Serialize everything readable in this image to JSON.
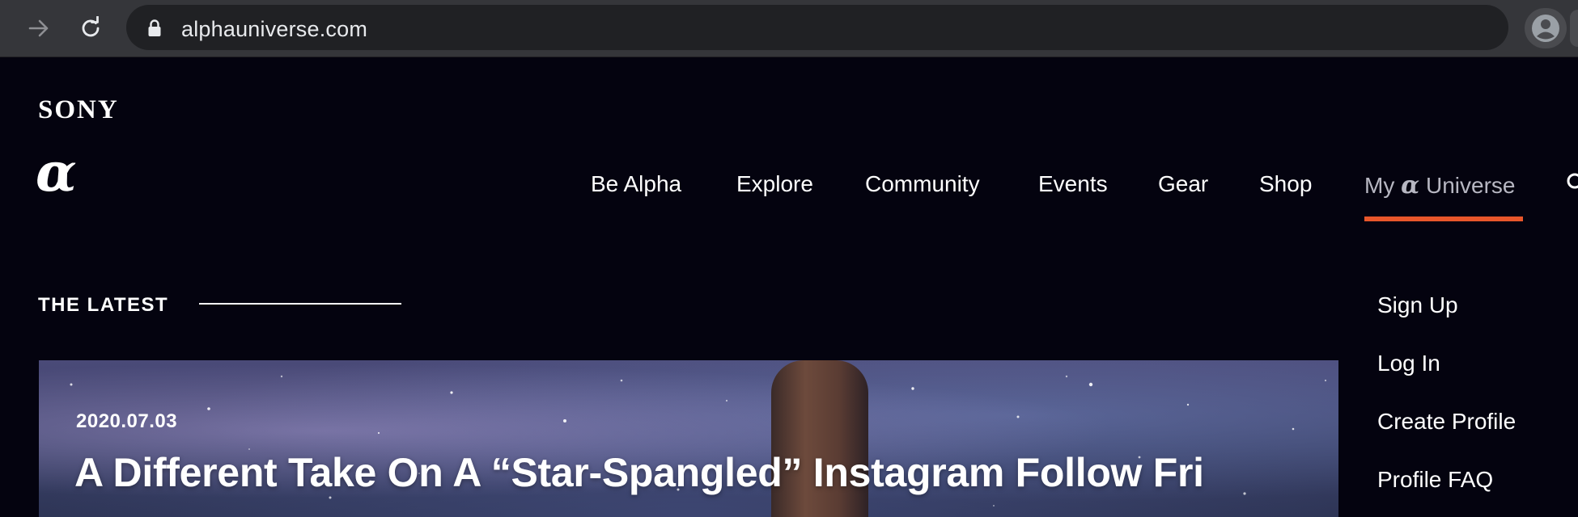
{
  "browser": {
    "url": "alphauniverse.com",
    "icons": {
      "forward": "arrow-right-icon",
      "reload": "reload-icon",
      "lock": "lock-icon",
      "profile": "user-avatar-icon"
    }
  },
  "site": {
    "brand": "SONY",
    "alpha_mark": "α"
  },
  "nav": {
    "items": [
      {
        "label": "Be Alpha"
      },
      {
        "label": "Explore"
      },
      {
        "label": "Community"
      },
      {
        "label": "Events"
      },
      {
        "label": "Gear"
      },
      {
        "label": "Shop"
      }
    ],
    "my_universe": {
      "prefix": "My",
      "glyph": "α",
      "suffix": "Universe"
    },
    "accent_color": "#e8562a"
  },
  "latest": {
    "label": "THE LATEST",
    "featured": {
      "date": "2020.07.03",
      "title": "A Different Take On A “Star-Spangled” Instagram Follow Fri"
    }
  },
  "dropdown": {
    "items": [
      {
        "label": "Sign Up"
      },
      {
        "label": "Log In"
      },
      {
        "label": "Create Profile"
      },
      {
        "label": "Profile FAQ"
      }
    ]
  }
}
